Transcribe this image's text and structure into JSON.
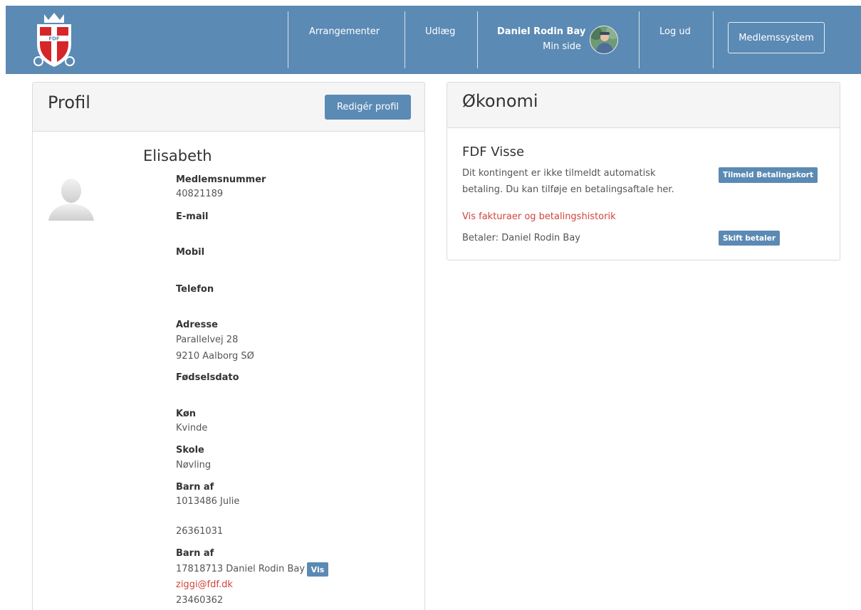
{
  "nav": {
    "events": "Arrangementer",
    "expenses": "Udlæg",
    "user_name": "Daniel Rodin Bay",
    "my_page": "Min side",
    "logout": "Log ud",
    "member_system": "Medlemssystem"
  },
  "logo_text": "FDF",
  "profile": {
    "title": "Profil",
    "edit_button": "Redigér profil",
    "name": "Elisabeth",
    "fields": {
      "member_number_label": "Medlemsnummer",
      "member_number": "40821189",
      "email_label": "E-mail",
      "mobile_label": "Mobil",
      "phone_label": "Telefon",
      "address_label": "Adresse",
      "address_line1": "Parallelvej 28",
      "address_line2": "9210 Aalborg SØ",
      "birthdate_label": "Fødselsdato",
      "gender_label": "Køn",
      "gender": "Kvinde",
      "school_label": "Skole",
      "school": "Nøvling",
      "child_of_label_1": "Barn af",
      "parent1": "1013486 Julie",
      "parent1_phone": "26361031",
      "child_of_label_2": "Barn af",
      "parent2": "17818713 Daniel Rodin Bay",
      "parent2_show": "Vis",
      "parent2_email": "ziggi@fdf.dk",
      "parent2_phone": "23460362"
    }
  },
  "economy": {
    "title": "Økonomi",
    "org_name": "FDF Visse",
    "desc_line1": "Dit kontingent er ikke tilmeldt automatisk",
    "desc_line2": "betaling. Du kan tilføje en betalingsaftale her.",
    "signup_card_button": "Tilmeld Betalingskort",
    "invoices_link": "Vis fakturaer og betalingshistorik",
    "payer": "Betaler: Daniel Rodin Bay",
    "change_payer_button": "Skift betaler"
  },
  "colors": {
    "primary": "#5b8ab4",
    "link": "#d0453d",
    "logo_red": "#d6262a"
  }
}
